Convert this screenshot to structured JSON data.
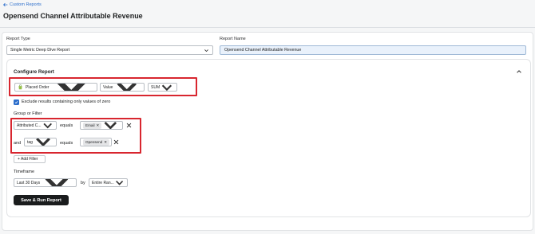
{
  "nav": {
    "back_label": "Custom Reports"
  },
  "page": {
    "title": "Opensend Channel Attributable Revenue"
  },
  "report_type": {
    "label": "Report Type",
    "value": "Single Metric Deep Dive Report"
  },
  "report_name": {
    "label": "Report Name",
    "value": "Opensend Channel Attributable Revenue"
  },
  "configure": {
    "title": "Configure Report",
    "metric": "Placed Order",
    "measure": "Value",
    "aggregation": "SUM",
    "exclude_zero_label": "Exclude results containing only values of zero"
  },
  "group_filter": {
    "label": "Group or Filter",
    "row1": {
      "field": "Attributed C...",
      "operator": "equals",
      "chip": "Email"
    },
    "row2": {
      "prefix": "and",
      "field": "tag",
      "operator": "equals",
      "chip": "Opensend"
    },
    "add_filter_label": "+ Add Filter"
  },
  "timeframe": {
    "label": "Timeframe",
    "range": "Last 30 Days",
    "by_label": "by",
    "granularity": "Entire Ran..."
  },
  "actions": {
    "run_label": "Save & Run Report"
  },
  "colors": {
    "accent": "#2c6ecb",
    "highlight": "#d8262f",
    "primary_button": "#1a1c1d"
  }
}
